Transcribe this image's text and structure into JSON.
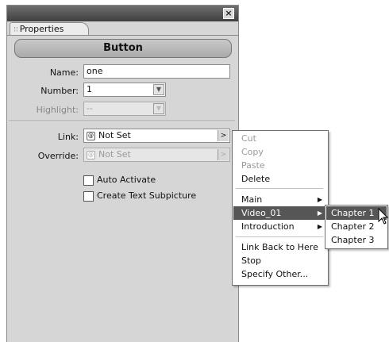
{
  "panel": {
    "tab_label": "Properties",
    "close_glyph": "×",
    "object_title": "Button"
  },
  "fields": {
    "name_label": "Name:",
    "name_value": "one",
    "number_label": "Number:",
    "number_value": "1",
    "highlight_label": "Highlight:",
    "highlight_value": "--",
    "link_label": "Link:",
    "link_value": "Not Set",
    "override_label": "Override:",
    "override_value": "Not Set"
  },
  "checkboxes": {
    "auto_activate": "Auto Activate",
    "auto_activate_checked": false,
    "create_text_subpicture": "Create Text Subpicture",
    "create_text_subpicture_checked": false
  },
  "context_menu": {
    "items": [
      "Cut",
      "Copy",
      "Paste",
      "Delete",
      "Main",
      "Video_01",
      "Introduction",
      "Link Back to Here",
      "Stop",
      "Specify Other..."
    ]
  },
  "submenu": {
    "items": [
      "Chapter 1",
      "Chapter 2",
      "Chapter 3"
    ]
  },
  "icons": {
    "link": "link-target-icon",
    "submenu": "submenu-arrow-icon",
    "cursor": "mouse-pointer-icon"
  },
  "colors": {
    "panel_bg": "#d6d6d6",
    "highlight": "#565656"
  }
}
